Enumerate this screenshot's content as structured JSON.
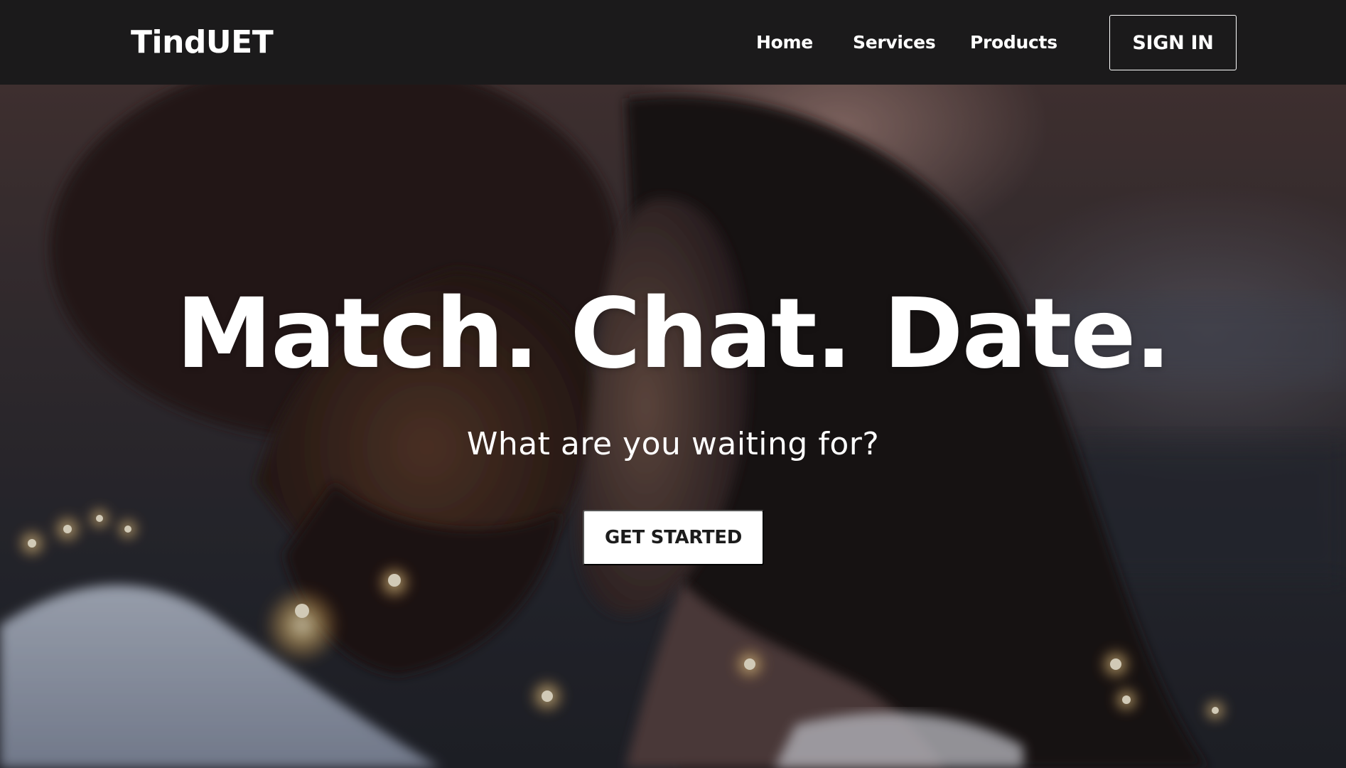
{
  "nav": {
    "brand": "TindUET",
    "links": [
      {
        "label": "Home"
      },
      {
        "label": "Services"
      },
      {
        "label": "Products"
      }
    ],
    "signin_label": "SIGN IN"
  },
  "hero": {
    "title": "Match. Chat. Date.",
    "subtitle": "What are you waiting for?",
    "cta_label": "GET STARTED"
  },
  "colors": {
    "navbar_bg": "#1b1a1b",
    "text": "#ffffff",
    "cta_bg": "#ffffff",
    "cta_text": "#1c1c1c"
  }
}
